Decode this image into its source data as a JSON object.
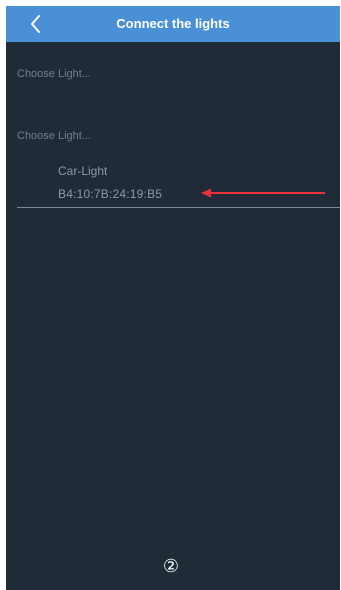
{
  "navbar": {
    "title": "Connect the lights",
    "back_icon": "chevron-left-icon"
  },
  "sections": {
    "label_1": "Choose Light...",
    "label_2": "Choose Light..."
  },
  "device": {
    "name": "Car-Light",
    "mac": "B4:10:7B:24:19:B5"
  },
  "step_number": "②",
  "colors": {
    "navbar": "#4a90d6",
    "background": "#1f2b36",
    "arrow": "#e8333c",
    "muted_text": "#6f8090"
  }
}
